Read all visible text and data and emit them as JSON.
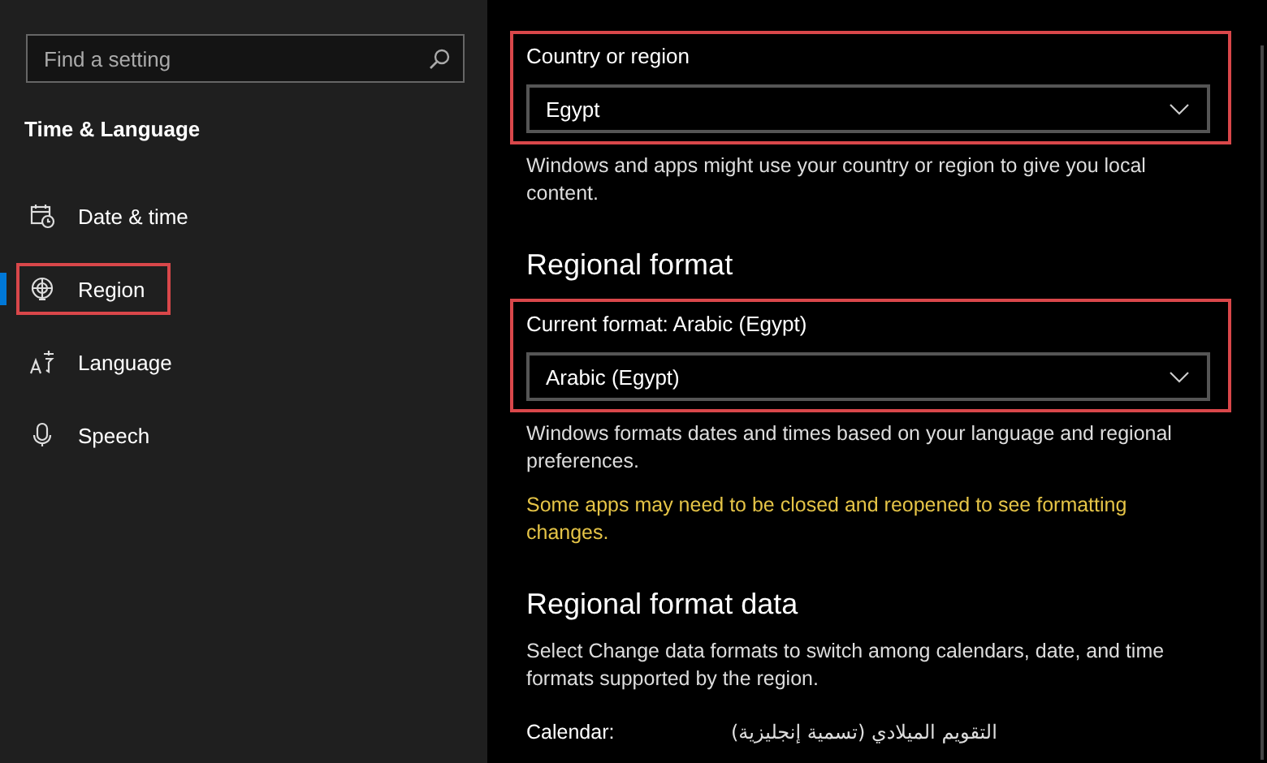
{
  "search": {
    "placeholder": "Find a setting"
  },
  "sidebar": {
    "title": "Time & Language",
    "items": [
      {
        "label": "Date & time",
        "selected": false,
        "highlighted": false
      },
      {
        "label": "Region",
        "selected": true,
        "highlighted": true
      },
      {
        "label": "Language",
        "selected": false,
        "highlighted": false
      },
      {
        "label": "Speech",
        "selected": false,
        "highlighted": false
      }
    ]
  },
  "main": {
    "blocks": [
      {
        "kind": "dropdown",
        "label": "Country or region",
        "value": "Egypt",
        "highlighted": true
      },
      {
        "kind": "text",
        "text": "Windows and apps might use your country or region to give you local content."
      },
      {
        "kind": "heading",
        "text": "Regional format"
      },
      {
        "kind": "dropdown",
        "label": "Current format: Arabic (Egypt)",
        "value": "Arabic (Egypt)",
        "highlighted": true
      },
      {
        "kind": "text",
        "text": "Windows formats dates and times based on your language and regional preferences."
      },
      {
        "kind": "warning",
        "text": "Some apps may need to be closed and reopened to see formatting changes."
      },
      {
        "kind": "heading",
        "text": "Regional format data"
      },
      {
        "kind": "text",
        "text": "Select Change data formats to switch among calendars, date, and time formats supported by the region."
      },
      {
        "kind": "field",
        "label": "Calendar:",
        "value": "التقويم الميلادي (تسمية إنجليزية)"
      }
    ]
  }
}
